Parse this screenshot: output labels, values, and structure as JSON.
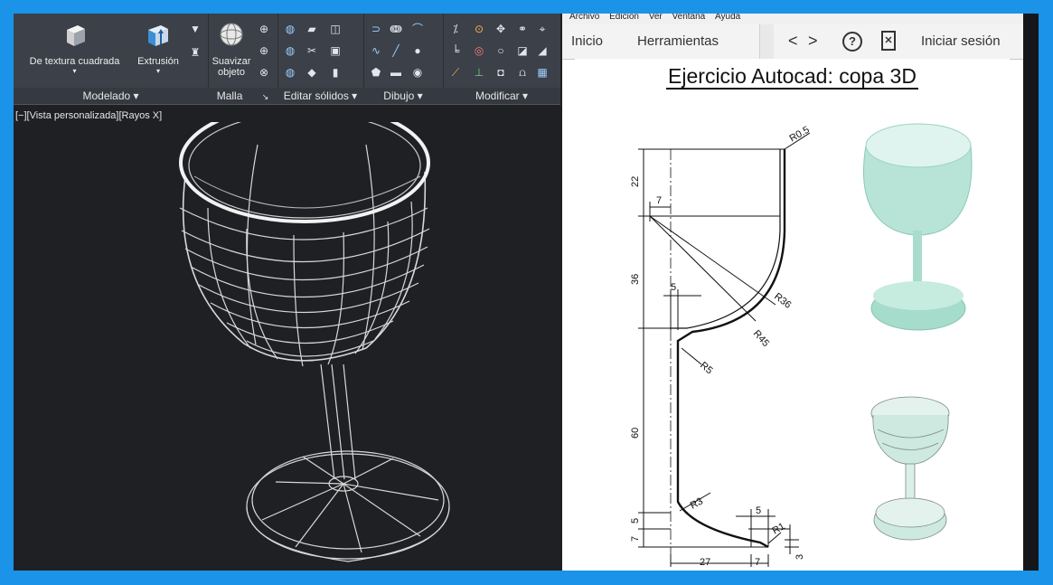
{
  "ribbon": {
    "btn_texture": "De textura cuadrada",
    "btn_extrusion": "Extrusión",
    "btn_smooth_line1": "Suavizar",
    "btn_smooth_line2": "objeto",
    "groups": {
      "modelado": "Modelado ▾",
      "malla": "Malla",
      "malla_arrow": "↘",
      "editar": "Editar sólidos ▾",
      "dibujo": "Dibujo ▾",
      "modificar": "Modificar ▾"
    }
  },
  "viewport": {
    "label": "[−][Vista personalizada][Rayos X]"
  },
  "viewer": {
    "menu": [
      "Archivo",
      "Edición",
      "Ver",
      "Ventana",
      "Ayuda"
    ],
    "tab_inicio": "Inicio",
    "tab_herramientas": "Herramientas",
    "nav_back": "<",
    "nav_forward": ">",
    "help": "?",
    "login": "Iniciar sesión",
    "scroll_up": "▲",
    "scroll_mid": "≡"
  },
  "drawing": {
    "title": "Ejercicio Autocad: copa 3D",
    "dims": {
      "d22": "22",
      "d7a": "7",
      "d36": "36",
      "d5a": "5",
      "d60": "60",
      "d5b": "5",
      "d7b": "7",
      "d27": "27",
      "d7c": "7",
      "d5c": "5",
      "d3": "3",
      "r05": "R0.5",
      "r36": "R36",
      "r45": "R45",
      "r5": "R5",
      "r3": "R3",
      "r1": "R1"
    }
  },
  "colors": {
    "frame": "#1a93e8",
    "ribbon": "#3b4049",
    "viewport_bg": "#1f2024",
    "glass_fill": "#a6dccb"
  }
}
